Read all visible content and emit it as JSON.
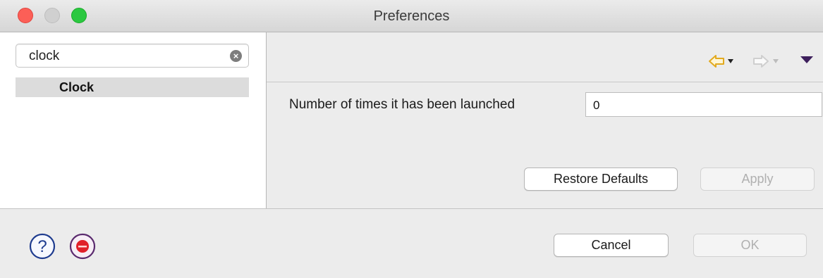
{
  "window": {
    "title": "Preferences"
  },
  "sidebar": {
    "search": {
      "value": "clock"
    },
    "items": [
      {
        "label": "Clock"
      }
    ]
  },
  "toolbar": {
    "icons": [
      "back-arrow-icon",
      "forward-arrow-icon",
      "view-menu-icon"
    ],
    "colors": {
      "back_arrow": "#e8b830",
      "forward_arrow": "#d8d8d8",
      "menu": "#3d1f5c"
    }
  },
  "page": {
    "field_label": "Number of times it has been launched",
    "field_value": "0",
    "restore_label": "Restore Defaults",
    "apply_label": "Apply"
  },
  "footer": {
    "cancel_label": "Cancel",
    "ok_label": "OK",
    "icons": [
      "help-icon",
      "stop-icon"
    ]
  },
  "colors": {
    "close": "#fc5f57",
    "zoom": "#2bc840",
    "stop": "#e0202a"
  }
}
